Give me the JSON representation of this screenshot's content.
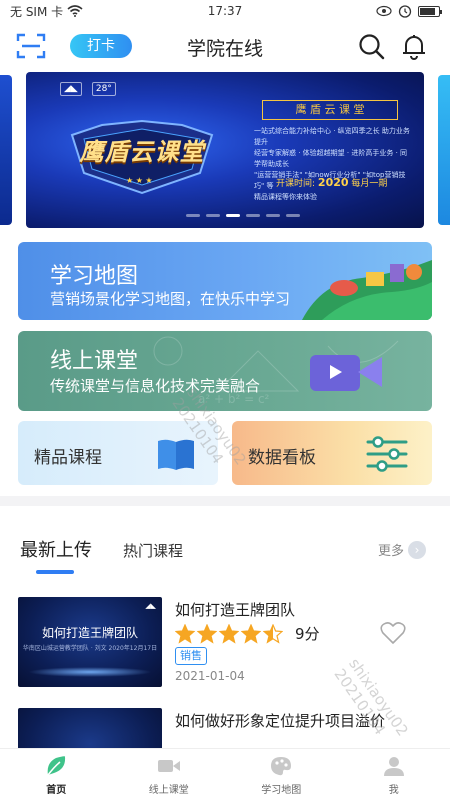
{
  "status_bar": {
    "carrier": "无 SIM 卡",
    "time": "17:37",
    "battery_level": 0.85
  },
  "header": {
    "checkin_label": "打卡",
    "title": "学院在线"
  },
  "banner": {
    "title": "鹰盾云课堂",
    "tag": "鹰 盾 云 课 堂",
    "logo_text": "28°",
    "desc_lines": [
      "一站式综合能力补给中心 · 纵览四季之长 助力业务提升",
      "经营专家解惑 · 体验超越期望 · 进阶高手业务 · 同学帮助成长",
      "\"运营营销手法\" \"如now行业分析\" \"如top营销技巧\" 等",
      "精品课程等你来体验"
    ],
    "start_label": "开课时间:",
    "start_year": "2020",
    "start_suffix": "每月一期",
    "slides_total": 6,
    "slides_active": 3
  },
  "cards": {
    "map": {
      "title": "学习地图",
      "subtitle": "营销场景化学习地图，在快乐中学习"
    },
    "online_class": {
      "title": "线上课堂",
      "subtitle": "传统课堂与信息化技术完美融合"
    },
    "quality_courses": {
      "title": "精品课程"
    },
    "data_board": {
      "title": "数据看板"
    }
  },
  "tabs": {
    "latest": "最新上传",
    "hot": "热门课程",
    "more": "更多"
  },
  "courses": [
    {
      "title": "如何打造王牌团队",
      "rating": 4.5,
      "score": "9分",
      "tag": "销售",
      "date": "2021-01-04",
      "thumb_title": "如何打造王牌团队",
      "thumb_sub": "华南区山城运营教学团队 · 刘文 2020年12月17日"
    },
    {
      "title": "如何做好形象定位提升项目溢价"
    }
  ],
  "watermarks": [
    {
      "line1": "shixiaoyu02",
      "line2": "20210104"
    },
    {
      "line1": "shixiaoyu02",
      "line2": "20210104"
    }
  ],
  "navbar": {
    "items": [
      "首页",
      "线上课堂",
      "学习地图",
      "我"
    ],
    "active": "首页"
  },
  "colors": {
    "accent": "#2f7df3",
    "star": "#f6a623",
    "home_active": "#3fc38a"
  }
}
